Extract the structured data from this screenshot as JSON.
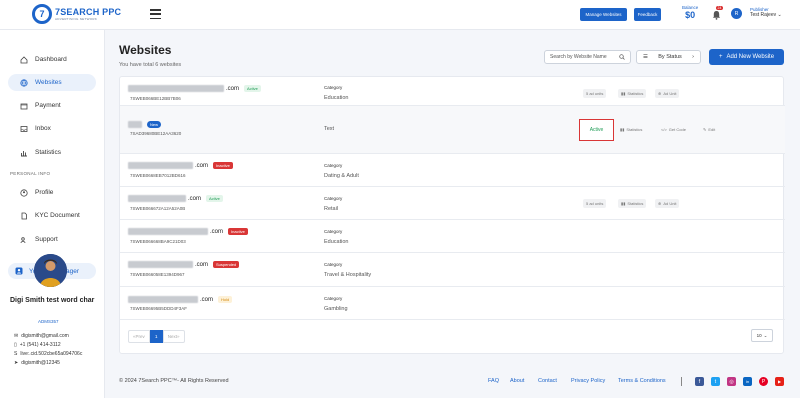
{
  "header": {
    "logo_mark": "7",
    "logo_name": "7SEARCH PPC",
    "logo_tag": "ADVERTISING NETWORK",
    "manage_websites_label": "Manage Websites",
    "feedback_label": "Feedback",
    "balance_label": "Balance",
    "balance_value": "$0",
    "notification_count": "24",
    "user_initial": "R",
    "user_role": "Publisher",
    "user_name": "Test Rajeev"
  },
  "sidebar": {
    "items": [
      {
        "label": "Dashboard"
      },
      {
        "label": "Websites"
      },
      {
        "label": "Payment"
      },
      {
        "label": "Inbox"
      },
      {
        "label": "Statistics"
      }
    ],
    "section_label": "PERSONAL INFO",
    "personal_items": [
      {
        "label": "Profile"
      },
      {
        "label": "KYC Document"
      },
      {
        "label": "Support"
      }
    ],
    "ad_manager_label": "Your Ad Manager",
    "manager": {
      "name": "Digi Smith test word char",
      "id": "ADMS357",
      "email": "digismith@gmail.com",
      "phone": "+1 (541) 414-3112",
      "skype": "live:.cid.502cbe65a094706c",
      "telegram": "digismith@12345"
    }
  },
  "main": {
    "title": "Websites",
    "subtitle": "You have total 6 websites",
    "search_placeholder": "Search by Website Name",
    "status_filter_label": "By Status",
    "add_button_label": "Add New Website",
    "rows": [
      {
        "domain_suffix": ".com",
        "status": "Active",
        "status_kind": "active",
        "code": "7SWEB066BE12BB7B06",
        "category_label": "Category",
        "category": "Education",
        "actions": [
          "5 ad units",
          "Statistics",
          "Ad Unit"
        ]
      },
      {
        "domain_suffix": "",
        "status": "New",
        "status_kind": "new",
        "code": "7SAD39680BE12AA3620",
        "category_label": "",
        "category": "Text",
        "actions": [
          "Active",
          "Statistics",
          "Get Code",
          "Edit"
        ]
      },
      {
        "domain_suffix": ".com",
        "status": "Inactive",
        "status_kind": "inactive",
        "code": "7SWEB0668EB7012BD616",
        "category_label": "Category",
        "category": "Dating & Adult",
        "actions": []
      },
      {
        "domain_suffix": ".com",
        "status": "Active",
        "status_kind": "active",
        "code": "7SWEB066672A12A52A0B",
        "category_label": "Category",
        "category": "Retail",
        "actions": [
          "5 ad units",
          "Statistics",
          "Ad Unit"
        ]
      },
      {
        "domain_suffix": ".com",
        "status": "Inactive",
        "status_kind": "inactive",
        "code": "7SWEB066668BA9C21D03",
        "category_label": "Category",
        "category": "Education",
        "actions": []
      },
      {
        "domain_suffix": ".com",
        "status": "Suspended",
        "status_kind": "suspended",
        "code": "7SWEB066058E1394D967",
        "category_label": "Category",
        "category": "Travel & Hospitality",
        "actions": []
      },
      {
        "domain_suffix": ".com",
        "status": "Hold",
        "status_kind": "hold",
        "code": "7SWEB06695B5DDD4F3AF",
        "category_label": "Category",
        "category": "Gambling",
        "actions": []
      }
    ],
    "pager": {
      "prev": "Prev",
      "current": "1",
      "next": "Next"
    },
    "per_page": "10"
  },
  "footer": {
    "copyright": "© 2024 7Search PPC™- All Rights Reserved",
    "links": [
      "FAQ",
      "About",
      "Contact",
      "Privacy Policy",
      "Terms & Conditions"
    ],
    "social": [
      {
        "name": "facebook",
        "color": "#3b5998",
        "glyph": "f"
      },
      {
        "name": "twitter",
        "color": "#1da1f2",
        "glyph": "t"
      },
      {
        "name": "instagram",
        "color": "#c13584",
        "glyph": "◎"
      },
      {
        "name": "linkedin",
        "color": "#0a66c2",
        "glyph": "in"
      },
      {
        "name": "pinterest",
        "color": "#e60023",
        "glyph": "P"
      },
      {
        "name": "youtube",
        "color": "#e62117",
        "glyph": "▶"
      }
    ]
  }
}
